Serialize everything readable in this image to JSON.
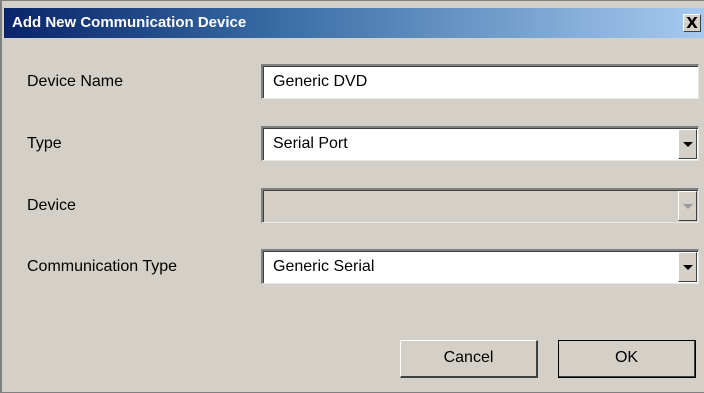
{
  "window": {
    "title": "Add New Communication Device",
    "close_label": "X"
  },
  "form": {
    "device_name": {
      "label": "Device Name",
      "value": "Generic DVD"
    },
    "type": {
      "label": "Type",
      "selected": "Serial Port"
    },
    "device": {
      "label": "Device",
      "selected": "",
      "enabled": false
    },
    "communication_type": {
      "label": "Communication Type",
      "selected": "Generic Serial"
    }
  },
  "buttons": {
    "cancel_label": "Cancel",
    "ok_label": "OK"
  },
  "icons": {
    "close": "close-icon",
    "dropdown": "chevron-down-icon"
  },
  "colors": {
    "title_bar_start": "#0a246a",
    "title_bar_end": "#a6caf0",
    "dialog_background": "#d4d0c8"
  }
}
